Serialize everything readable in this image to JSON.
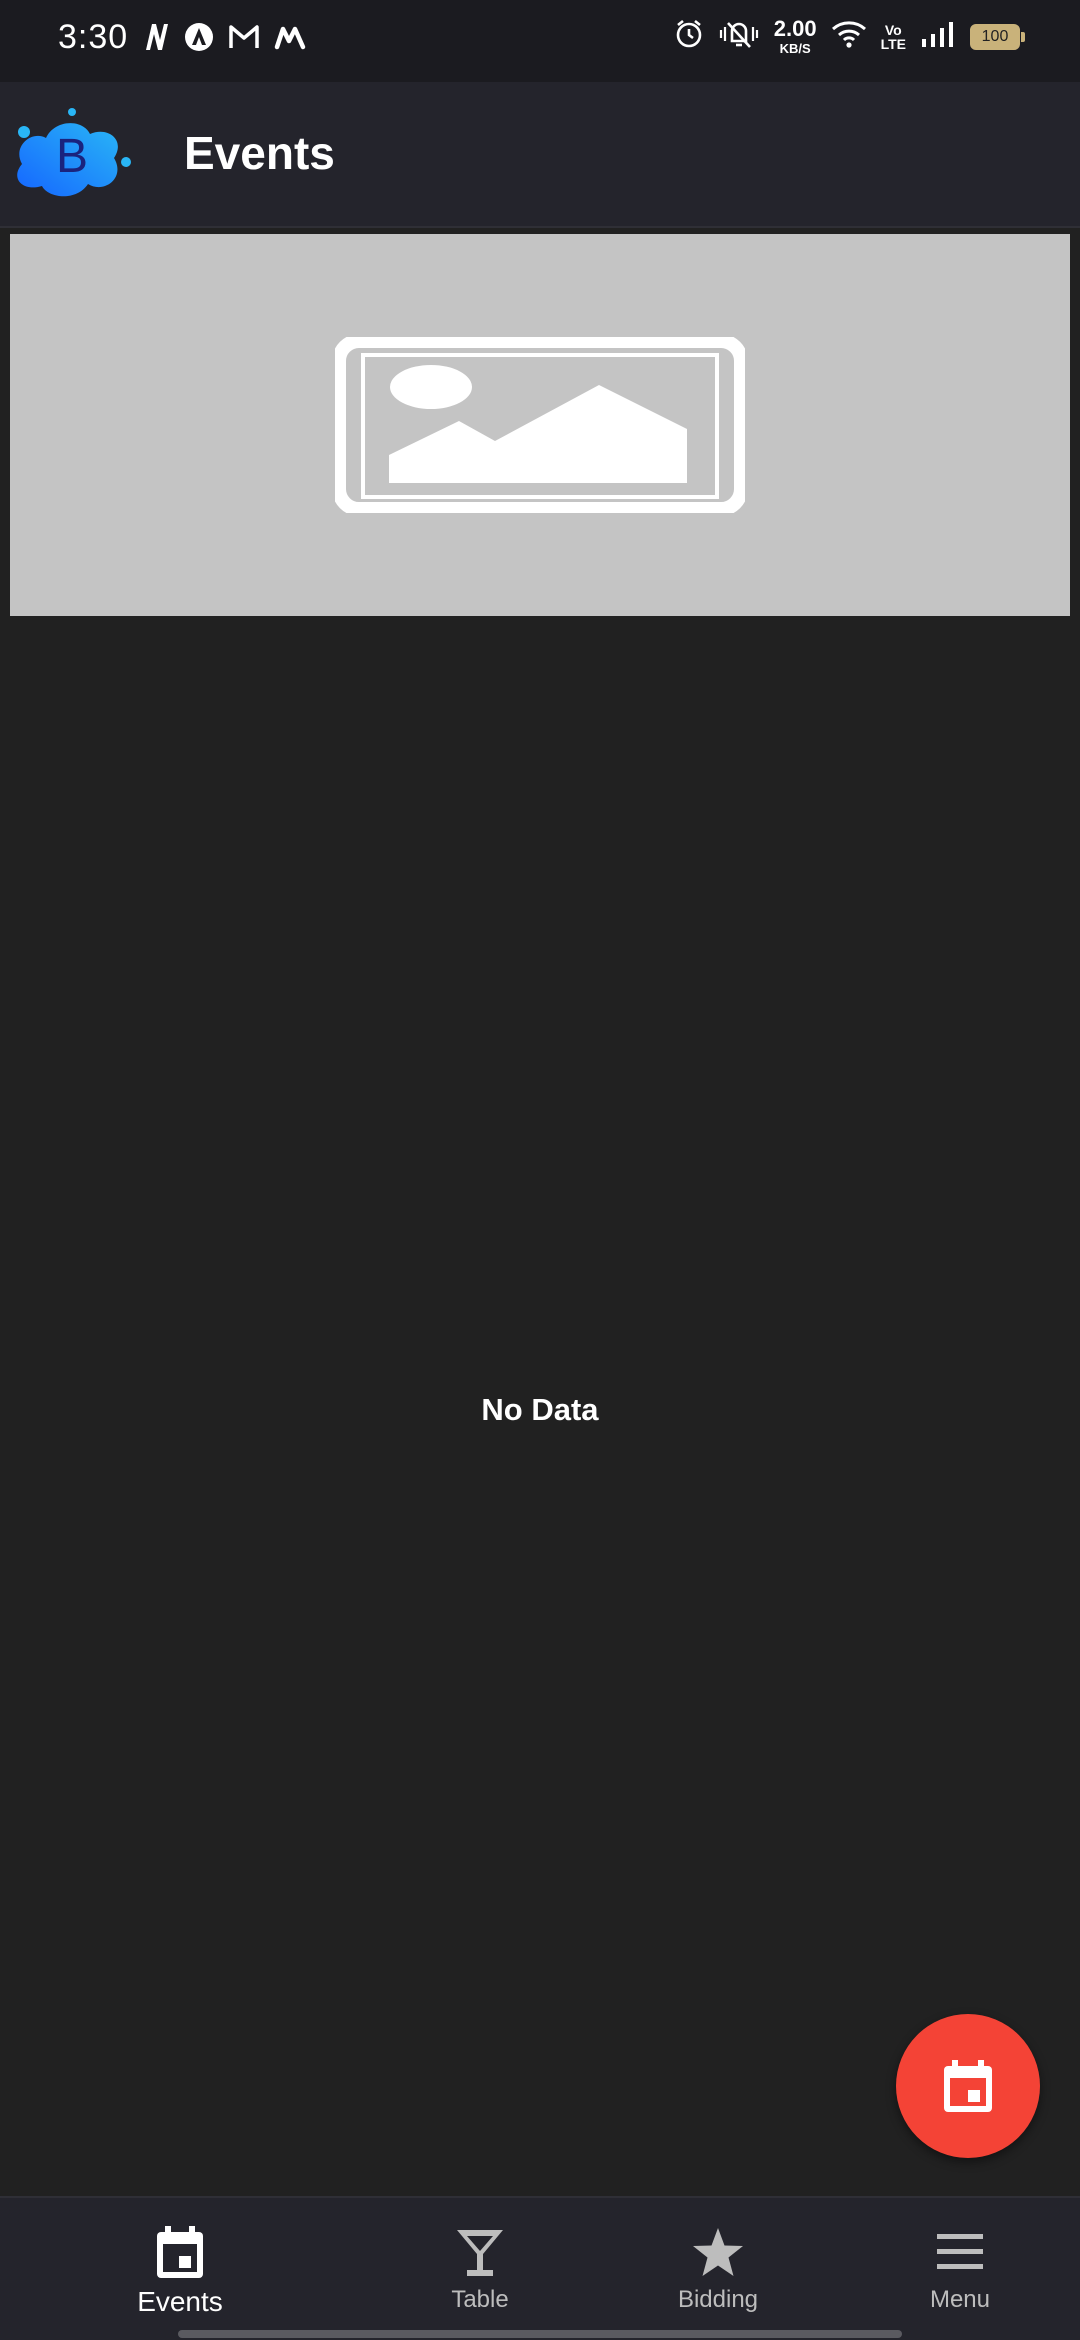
{
  "status_bar": {
    "time": "3:30",
    "net_speed_value": "2.00",
    "net_speed_unit": "KB/S",
    "volte_line1": "Vo",
    "volte_line2": "LTE",
    "battery": "100",
    "icons": [
      "n-icon",
      "a-icon",
      "gmail-icon",
      "m-icon",
      "alarm-icon",
      "vibrate-off-icon",
      "wifi-icon",
      "signal-icon",
      "battery-icon"
    ]
  },
  "app_bar": {
    "logo_letter": "B",
    "title": "Events",
    "logo_color": "#1e88e5"
  },
  "banner": {
    "icon": "image-placeholder-icon",
    "background": "#c4c4c4"
  },
  "main": {
    "empty_text": "No Data"
  },
  "fab": {
    "icon": "calendar-icon",
    "color": "#f44336"
  },
  "bottom_nav": {
    "items": [
      {
        "label": "Events",
        "icon": "calendar-icon",
        "active": true
      },
      {
        "label": "Table",
        "icon": "cocktail-icon",
        "active": false
      },
      {
        "label": "Bidding",
        "icon": "star-icon",
        "active": false
      },
      {
        "label": "Menu",
        "icon": "menu-icon",
        "active": false
      }
    ]
  }
}
